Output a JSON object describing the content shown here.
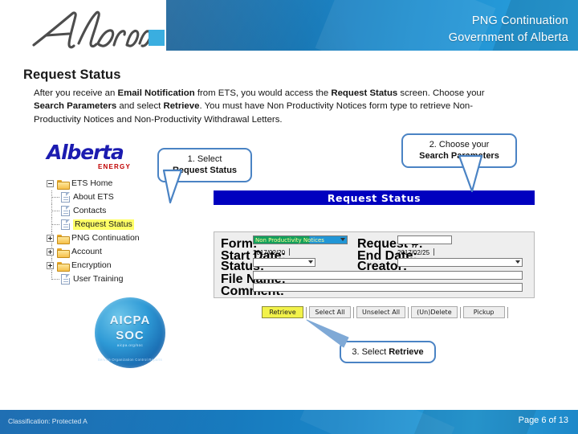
{
  "header": {
    "brand_wordmark": "Alberta",
    "title_line1": "PNG Continuation",
    "title_line2": "Government of Alberta",
    "band_color": "#1a7dbd",
    "accent_square_color": "#3aaee0"
  },
  "content": {
    "page_title": "Request Status",
    "paragraph_part1": "After you receive an ",
    "paragraph_bold1": "Email Notification",
    "paragraph_part2": " from ETS, you would access the ",
    "paragraph_bold2": "Request Status",
    "paragraph_part3": " screen.  Choose your ",
    "paragraph_bold3": "Search Parameters",
    "paragraph_part4": " and select ",
    "paragraph_bold4": "Retrieve",
    "paragraph_part5": ".  You must have Non Productivity Notices form type to retrieve Non-Productivity Notices and Non-Productivity Withdrawal Letters."
  },
  "ae_logo": {
    "name": "Alberta",
    "division": "ENERGY",
    "name_color": "#1b1bb0",
    "division_color": "#c00000"
  },
  "tree": {
    "root": "ETS Home",
    "items": [
      {
        "label": "About ETS",
        "icon": "document-icon",
        "expander": "none",
        "highlighted": false
      },
      {
        "label": "Contacts",
        "icon": "document-icon",
        "expander": "none",
        "highlighted": false
      },
      {
        "label": "Request Status",
        "icon": "document-icon",
        "expander": "none",
        "highlighted": true
      },
      {
        "label": "PNG Continuation",
        "icon": "folder-icon",
        "expander": "plus",
        "highlighted": false
      },
      {
        "label": "Account",
        "icon": "folder-icon",
        "expander": "plus",
        "highlighted": false
      },
      {
        "label": "Encryption",
        "icon": "folder-icon",
        "expander": "plus",
        "highlighted": false
      },
      {
        "label": "User Training",
        "icon": "document-icon",
        "expander": "none",
        "highlighted": false
      }
    ]
  },
  "soc_badge": {
    "line1": "AICPA",
    "line2": "SOC",
    "sub": "aicpa.org/soc",
    "ring": "Service Organization Control Reports"
  },
  "ets": {
    "banner_title": "Request Status",
    "banner_bg": "#0000bf",
    "fields": {
      "form_label": "Form:",
      "form_value": "Non Productivity Notices",
      "request_no_label": "Request #:",
      "request_no_value": "",
      "start_date_label": "Start Date:",
      "start_date_value": "2017/02/20",
      "end_date_label": "End Date:",
      "end_date_value": "2017/02/25",
      "status_label": "Status:",
      "status_value": "",
      "creator_label": "Creator:",
      "creator_value": "",
      "file_name_label": "File Name:",
      "file_name_value": "",
      "comment_label": "Comment:",
      "comment_value": ""
    },
    "buttons": [
      {
        "label": "Retrieve",
        "active": true
      },
      {
        "label": "Select All",
        "active": false
      },
      {
        "label": "Unselect All",
        "active": false
      },
      {
        "label": "(Un)Delete",
        "active": false
      },
      {
        "label": "Pickup",
        "active": false
      }
    ]
  },
  "callouts": {
    "one_line1": "1. Select",
    "one_line2": "Request Status",
    "two_line1": "2. Choose your",
    "two_line2": "Search Parameters",
    "three_prefix": "3. Select ",
    "three_bold": "Retrieve",
    "border_color": "#4a83c4"
  },
  "footer": {
    "classification": "Classification: Protected A",
    "page": "Page 6 of 13"
  }
}
